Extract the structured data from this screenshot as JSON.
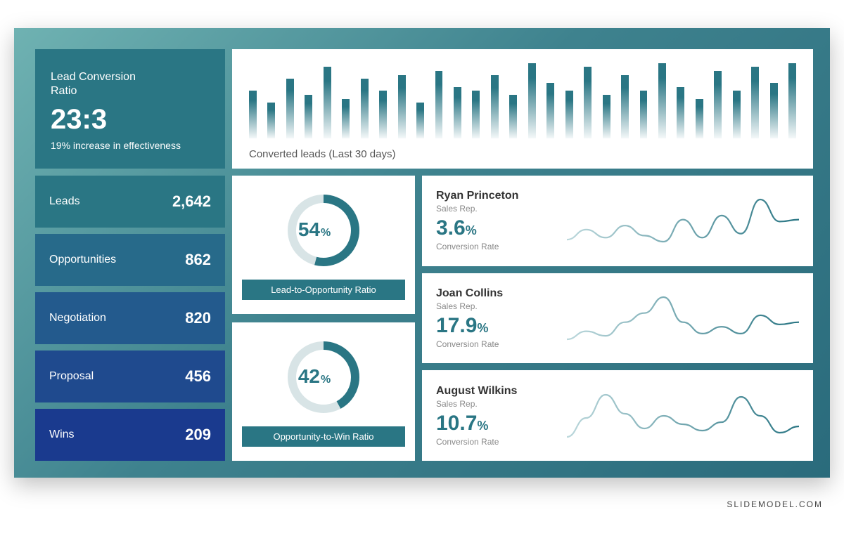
{
  "attribution": "SLIDEMODEL.COM",
  "ratio_card": {
    "label": "Lead Conversion\nRatio",
    "value": "23:3",
    "sub": "19% increase in effectiveness"
  },
  "bars_card": {
    "label": "Converted leads (Last 30 days)"
  },
  "funnel": [
    {
      "name": "Leads",
      "value": "2,642",
      "color": "#2a7684"
    },
    {
      "name": "Opportunities",
      "value": "862",
      "color": "#276a8a"
    },
    {
      "name": "Negotiation",
      "value": "820",
      "color": "#235a8d"
    },
    {
      "name": "Proposal",
      "value": "456",
      "color": "#1f4a8e"
    },
    {
      "name": "Wins",
      "value": "209",
      "color": "#1a3a8e"
    }
  ],
  "donuts": [
    {
      "percent": 54,
      "label": "Lead-to-Opportunity  Ratio"
    },
    {
      "percent": 42,
      "label": "Opportunity-to-Win  Ratio"
    }
  ],
  "reps": [
    {
      "name": "Ryan Princeton",
      "role": "Sales Rep.",
      "rate": "3.6",
      "sub": "Conversion Rate"
    },
    {
      "name": "Joan Collins",
      "role": "Sales Rep.",
      "rate": "17.9",
      "sub": "Conversion Rate"
    },
    {
      "name": "August Wilkins",
      "role": "Sales Rep.",
      "rate": "10.7",
      "sub": "Conversion Rate"
    }
  ],
  "chart_data": [
    {
      "type": "bar",
      "title": "Converted leads (Last 30 days)",
      "xlabel": "",
      "ylabel": "",
      "categories": [
        "1",
        "2",
        "3",
        "4",
        "5",
        "6",
        "7",
        "8",
        "9",
        "10",
        "11",
        "12",
        "13",
        "14",
        "15",
        "16",
        "17",
        "18",
        "19",
        "20",
        "21",
        "22",
        "23",
        "24",
        "25",
        "26",
        "27",
        "28",
        "29",
        "30"
      ],
      "values": [
        60,
        45,
        75,
        55,
        90,
        50,
        75,
        60,
        80,
        45,
        85,
        65,
        60,
        80,
        55,
        95,
        70,
        60,
        90,
        55,
        80,
        60,
        95,
        65,
        50,
        85,
        60,
        90,
        70,
        95
      ],
      "ylim": [
        0,
        100
      ]
    },
    {
      "type": "pie",
      "title": "Lead-to-Opportunity Ratio",
      "series": [
        {
          "name": "ratio",
          "values": [
            54,
            46
          ]
        }
      ]
    },
    {
      "type": "pie",
      "title": "Opportunity-to-Win Ratio",
      "series": [
        {
          "name": "ratio",
          "values": [
            42,
            58
          ]
        }
      ]
    },
    {
      "type": "line",
      "title": "Ryan Princeton conversion trend",
      "x": [
        0,
        1,
        2,
        3,
        4,
        5,
        6,
        7,
        8,
        9,
        10,
        11,
        12
      ],
      "values": [
        38,
        48,
        40,
        52,
        42,
        36,
        58,
        40,
        62,
        44,
        78,
        56,
        58
      ]
    },
    {
      "type": "line",
      "title": "Joan Collins conversion trend",
      "x": [
        0,
        1,
        2,
        3,
        4,
        5,
        6,
        7,
        8,
        9,
        10,
        11,
        12
      ],
      "values": [
        35,
        42,
        38,
        50,
        58,
        72,
        50,
        40,
        46,
        40,
        56,
        48,
        50
      ]
    },
    {
      "type": "line",
      "title": "August Wilkins conversion trend",
      "x": [
        0,
        1,
        2,
        3,
        4,
        5,
        6,
        7,
        8,
        9,
        10,
        11,
        12
      ],
      "values": [
        30,
        48,
        70,
        52,
        38,
        50,
        42,
        36,
        44,
        68,
        50,
        34,
        40
      ]
    }
  ]
}
